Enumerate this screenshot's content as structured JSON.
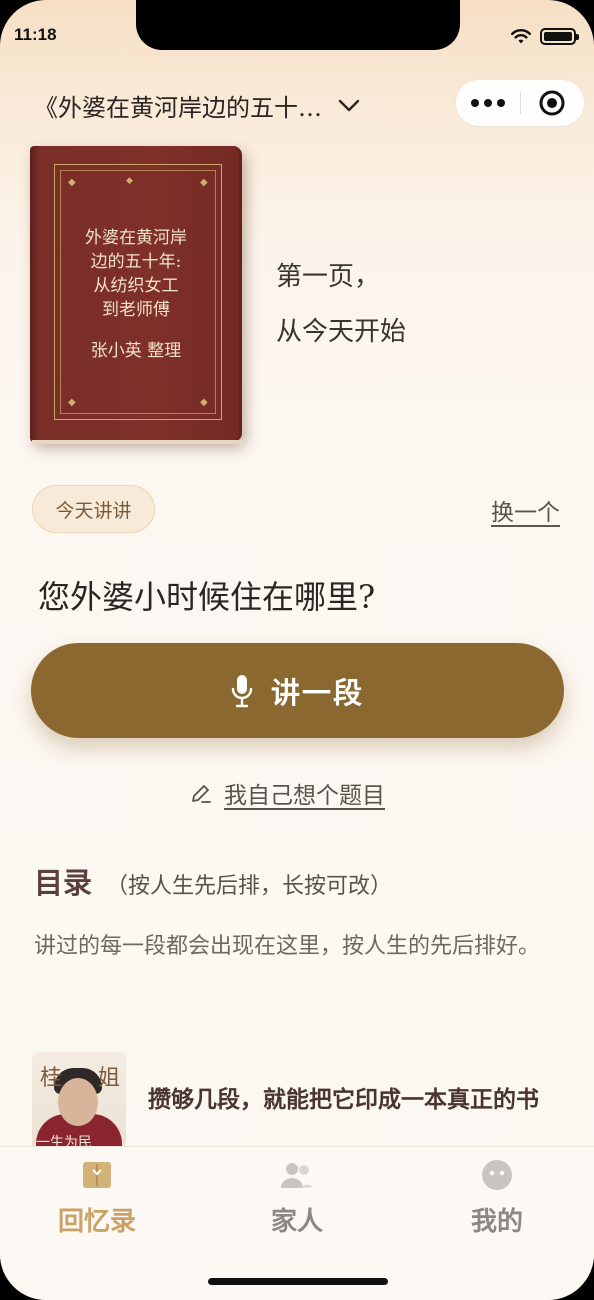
{
  "status": {
    "time": "11:18"
  },
  "nav": {
    "book_title": "《外婆在黄河岸边的五十…",
    "more_icon": "more-dots-icon",
    "close_icon": "target-close-icon"
  },
  "cover": {
    "title_line1": "外婆在黄河岸",
    "title_line2": "边的五十年:",
    "title_line3": "从纺织女工",
    "title_line4": "到老师傅",
    "author": "张小英 整理",
    "colors": {
      "leather": "#7e3029",
      "gold": "#c9a36a"
    }
  },
  "intro": {
    "line1": "第一页，",
    "line2": "从今天开始"
  },
  "prompt": {
    "tag": "今天讲讲",
    "switch": "换一个",
    "question": "您外婆小时候住在哪里?"
  },
  "record": {
    "label": "讲一段",
    "icon": "microphone-icon",
    "color": "#8b6830"
  },
  "custom_topic": {
    "label": "我自己想个题目",
    "icon": "pencil-icon"
  },
  "toc": {
    "title": "目录",
    "subtitle": "（按人生先后排，长按可改）",
    "description": "讲过的每一段都会出现在这里，按人生的先后排好。"
  },
  "preview": {
    "thumb_text_left": "桂",
    "thumb_text_right": "姐",
    "thumb_caption": "一生为民",
    "text": "攒够几段，就能把它印成一本真正的书"
  },
  "tabs": [
    {
      "label": "回忆录",
      "icon": "book-icon",
      "active": true
    },
    {
      "label": "家人",
      "icon": "people-icon",
      "active": false
    },
    {
      "label": "我的",
      "icon": "face-icon",
      "active": false
    }
  ],
  "accent": "#c8a267"
}
